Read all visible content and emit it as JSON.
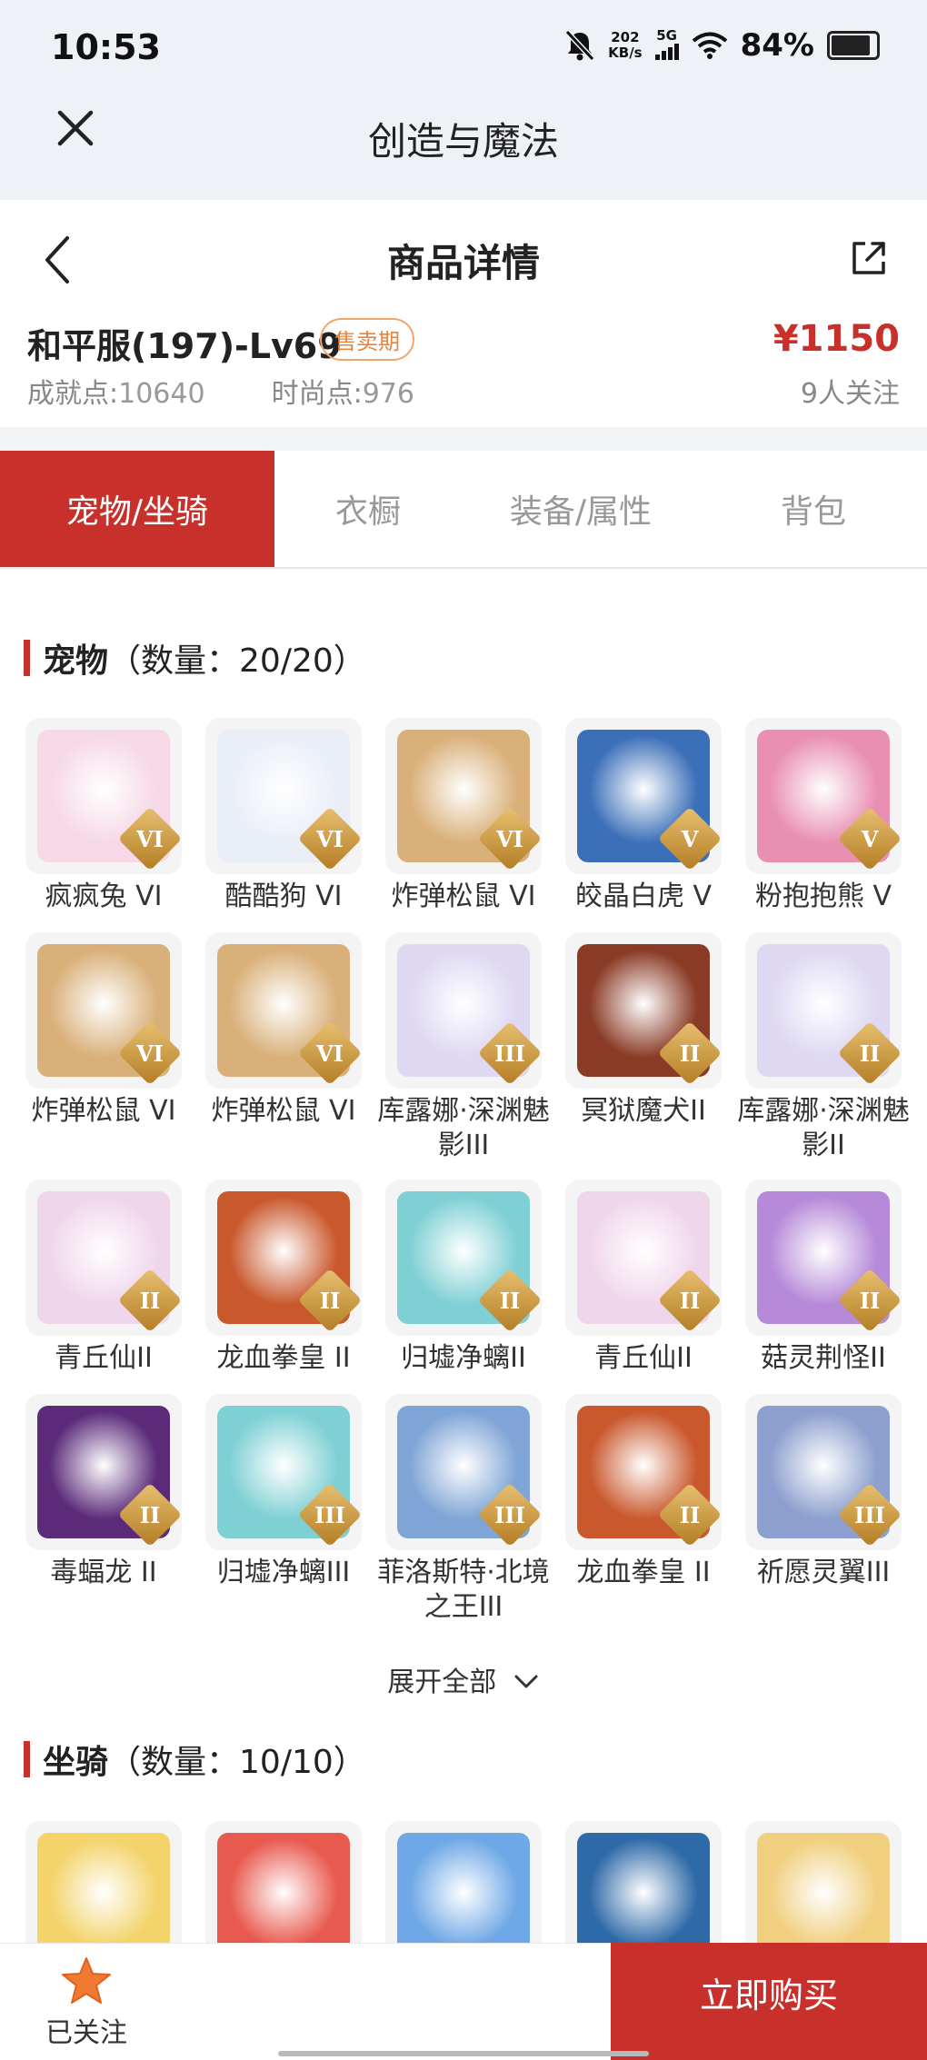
{
  "status_bar": {
    "time": "10:53",
    "net_speed_value": "202",
    "net_speed_unit": "KB/s",
    "network": "5G",
    "battery": "84%"
  },
  "app": {
    "title": "创造与魔法"
  },
  "detail": {
    "title": "商品详情"
  },
  "product": {
    "name": "和平服(197)-Lv69",
    "badge": "售卖期",
    "price": "¥1150",
    "achievement_label": "成就点:",
    "achievement_value": "10640",
    "fashion_label": "时尚点:",
    "fashion_value": "976",
    "followers": "9人关注"
  },
  "tabs": [
    {
      "label": "宠物/坐骑",
      "active": true
    },
    {
      "label": "衣橱",
      "active": false
    },
    {
      "label": "装备/属性",
      "active": false
    },
    {
      "label": "背包",
      "active": false
    }
  ],
  "pets_section": {
    "title": "宠物",
    "count": "（数量：20/20）"
  },
  "pets": [
    {
      "name": "疯疯兔 VI",
      "tier": "VI",
      "color": "#f6d8e6"
    },
    {
      "name": "酷酷狗 VI",
      "tier": "VI",
      "color": "#e9eef7"
    },
    {
      "name": "炸弹松鼠 VI",
      "tier": "VI",
      "color": "#d9b07a"
    },
    {
      "name": "皎晶白虎 V",
      "tier": "V",
      "color": "#3b6fb8"
    },
    {
      "name": "粉抱抱熊 V",
      "tier": "V",
      "color": "#e98fb2"
    },
    {
      "name": "炸弹松鼠 VI",
      "tier": "VI",
      "color": "#d9b07a"
    },
    {
      "name": "炸弹松鼠 VI",
      "tier": "VI",
      "color": "#d9b07a"
    },
    {
      "name": "库露娜·深渊魅影III",
      "tier": "III",
      "color": "#ded8f2"
    },
    {
      "name": "冥狱魔犬II",
      "tier": "II",
      "color": "#8a3b26"
    },
    {
      "name": "库露娜·深渊魅影II",
      "tier": "II",
      "color": "#ded8f2"
    },
    {
      "name": "青丘仙II",
      "tier": "II",
      "color": "#f0d6ea"
    },
    {
      "name": "龙血拳皇 II",
      "tier": "II",
      "color": "#c9582d"
    },
    {
      "name": "归墟净螭II",
      "tier": "II",
      "color": "#7fd0d4"
    },
    {
      "name": "青丘仙II",
      "tier": "II",
      "color": "#f0d6ea"
    },
    {
      "name": "菇灵荆怪II",
      "tier": "II",
      "color": "#b68ad8"
    },
    {
      "name": "毒蝠龙 II",
      "tier": "II",
      "color": "#5b2b7a"
    },
    {
      "name": "归墟净螭III",
      "tier": "III",
      "color": "#7fd0d4"
    },
    {
      "name": "菲洛斯特·北境之王III",
      "tier": "III",
      "color": "#7fa5d6"
    },
    {
      "name": "龙血拳皇 II",
      "tier": "II",
      "color": "#c9582d"
    },
    {
      "name": "祈愿灵翼III",
      "tier": "III",
      "color": "#8c9fce"
    }
  ],
  "expand_label": "展开全部",
  "mounts_section": {
    "title": "坐骑",
    "count": "（数量：10/10）"
  },
  "mounts": [
    {
      "name": "",
      "color": "#f3d36a"
    },
    {
      "name": "",
      "color": "#e85a4f"
    },
    {
      "name": "",
      "color": "#6fa8e6"
    },
    {
      "name": "",
      "color": "#2f6aa8"
    },
    {
      "name": "",
      "color": "#f0cf7e"
    }
  ],
  "bottom": {
    "follow_label": "已关注",
    "buy_label": "立即购买"
  },
  "colors": {
    "accent": "#c7302b",
    "badge": "#e8833a"
  }
}
